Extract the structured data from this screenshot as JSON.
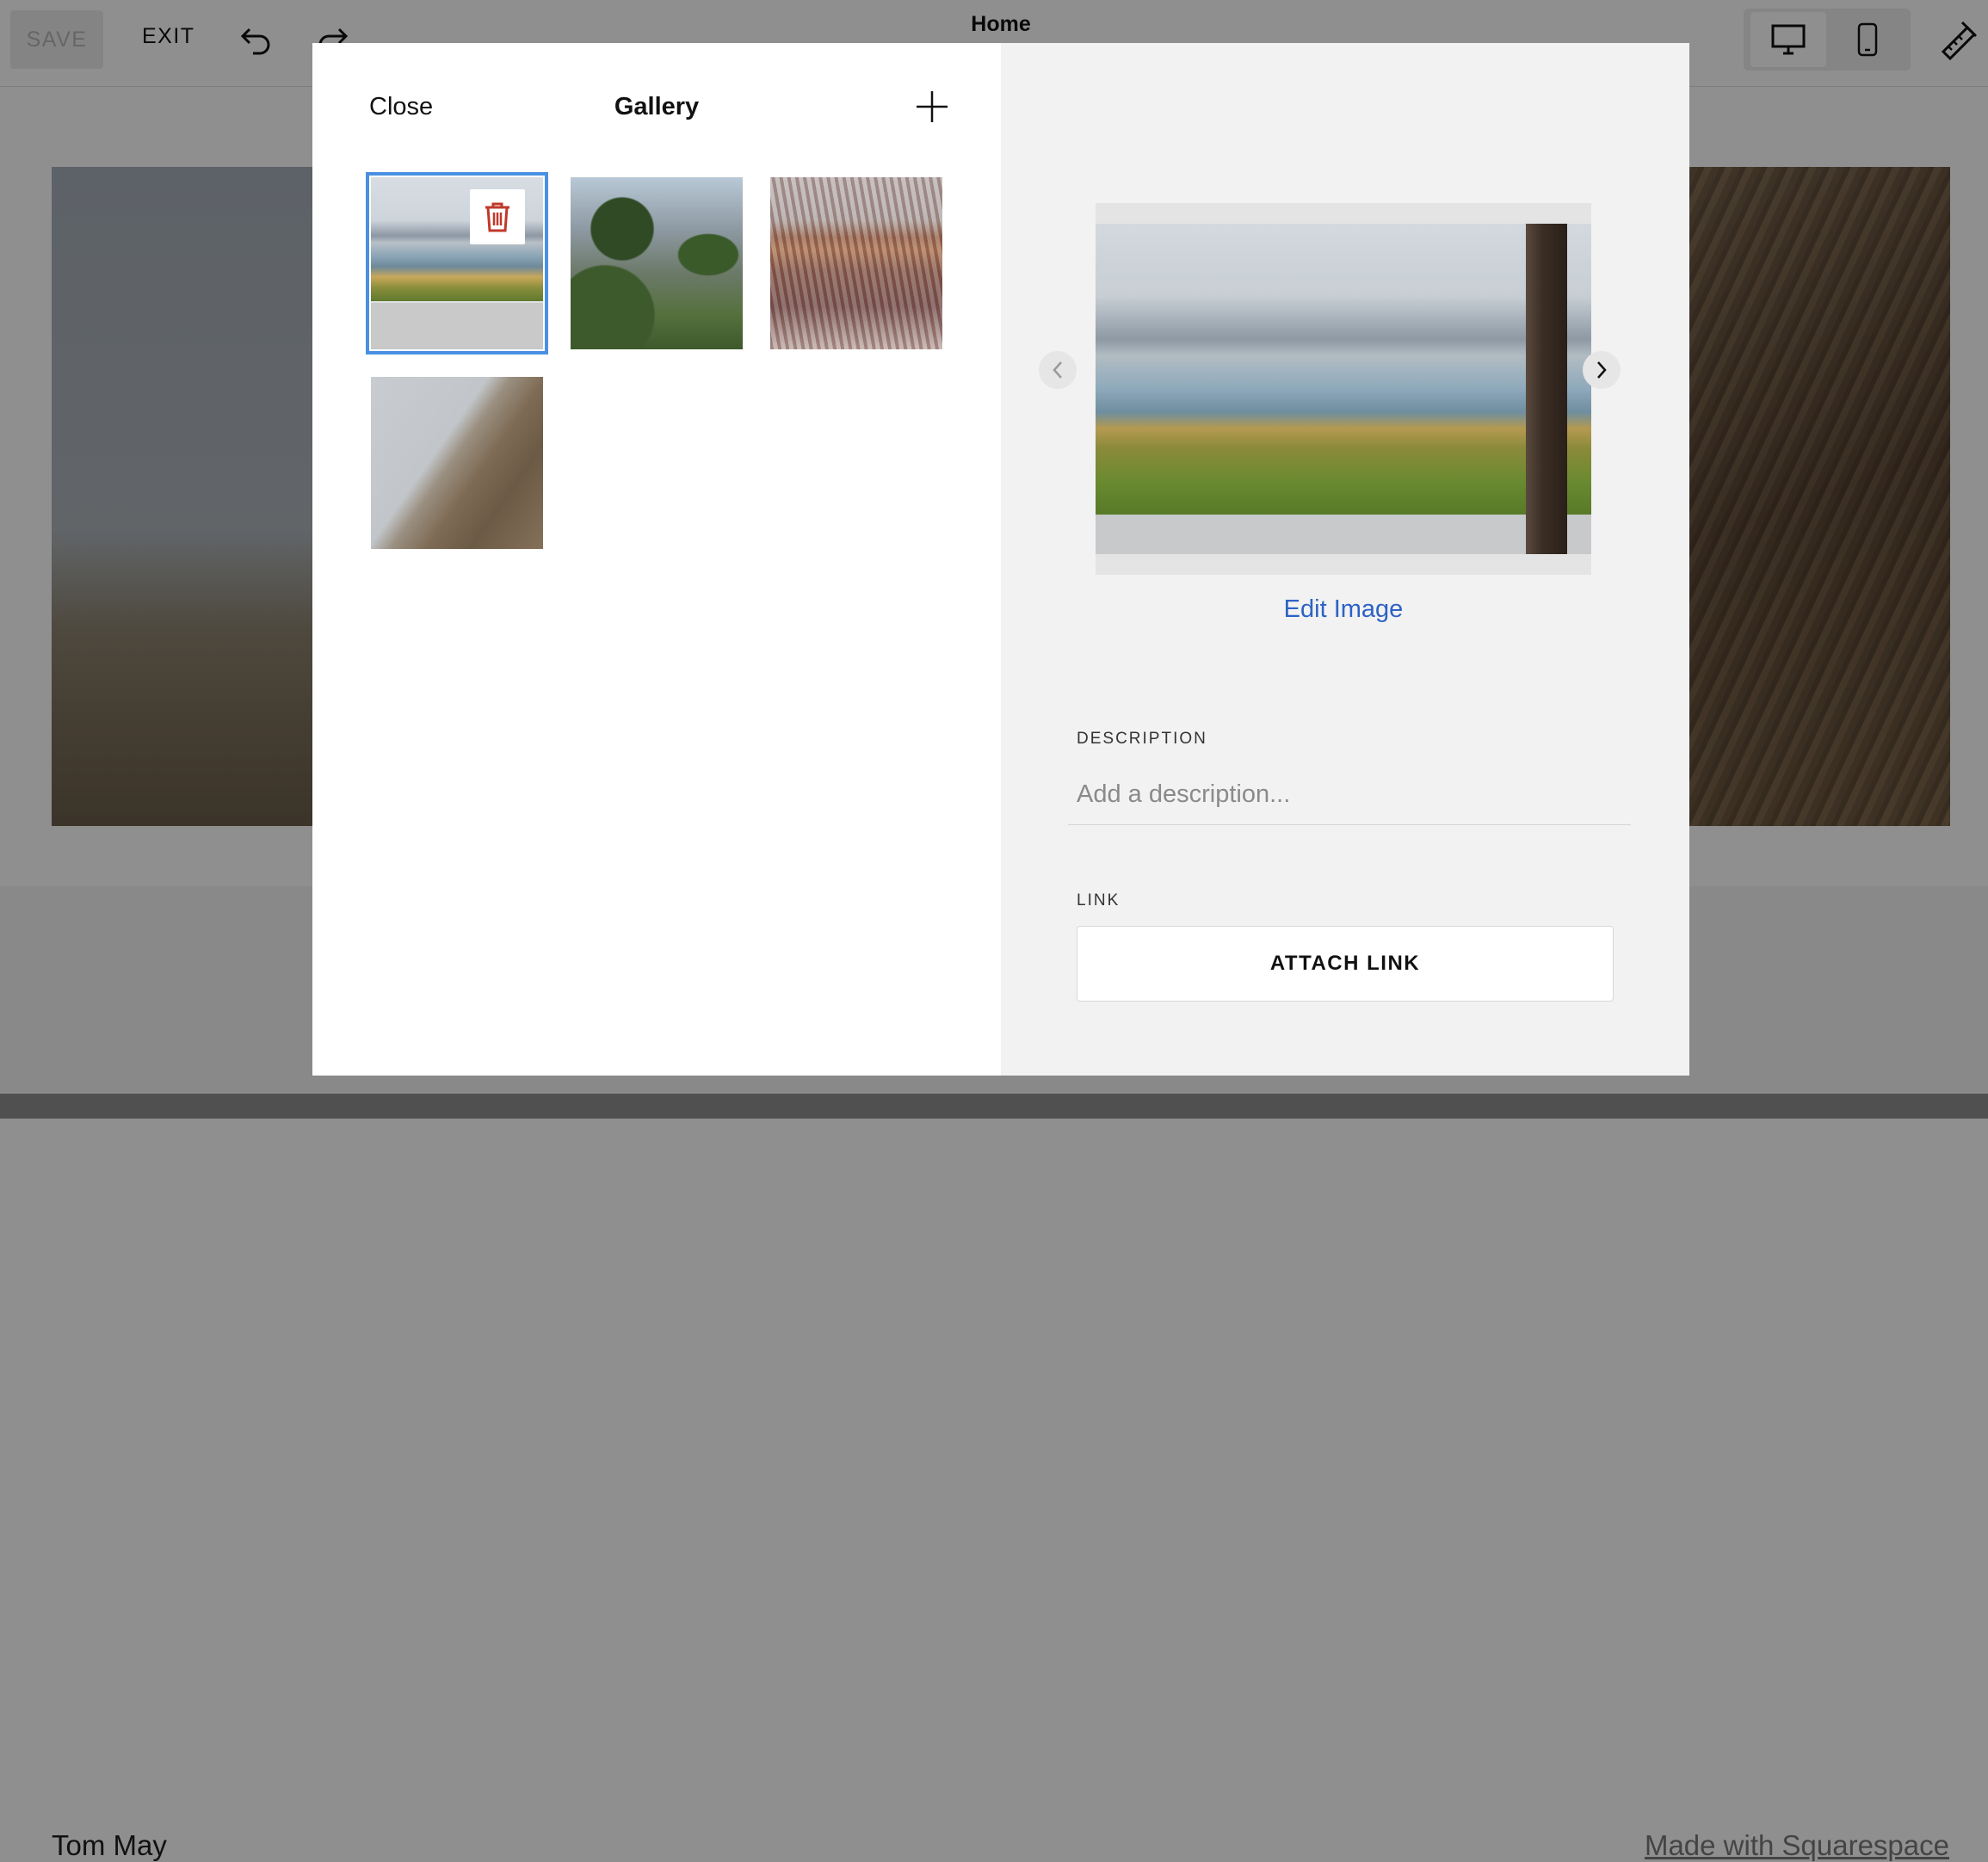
{
  "topbar": {
    "save_label": "SAVE",
    "exit_label": "EXIT",
    "page_title": "Home",
    "icons": {
      "undo": "undo-icon",
      "redo": "redo-icon",
      "desktop": "desktop-icon",
      "mobile": "mobile-icon",
      "design": "design-icon"
    }
  },
  "page": {
    "footer_name": "Tom May",
    "footer_link": "Made with Squarespace"
  },
  "modal": {
    "close_label": "Close",
    "title": "Gallery",
    "add_icon": "plus-icon",
    "thumbnails": [
      {
        "selected": true
      },
      {
        "selected": false
      },
      {
        "selected": false
      },
      {
        "selected": false
      }
    ],
    "delete_icon": "trash-icon",
    "preview": {
      "edit_label": "Edit Image",
      "prev_icon": "chevron-left-icon",
      "next_icon": "chevron-right-icon"
    },
    "description": {
      "label": "DESCRIPTION",
      "placeholder": "Add a description...",
      "value": ""
    },
    "link": {
      "label": "LINK",
      "button_label": "ATTACH LINK"
    }
  },
  "colors": {
    "accent_blue": "#4a90e2",
    "link_blue": "#2d62c4",
    "trash_red": "#c0392b"
  }
}
